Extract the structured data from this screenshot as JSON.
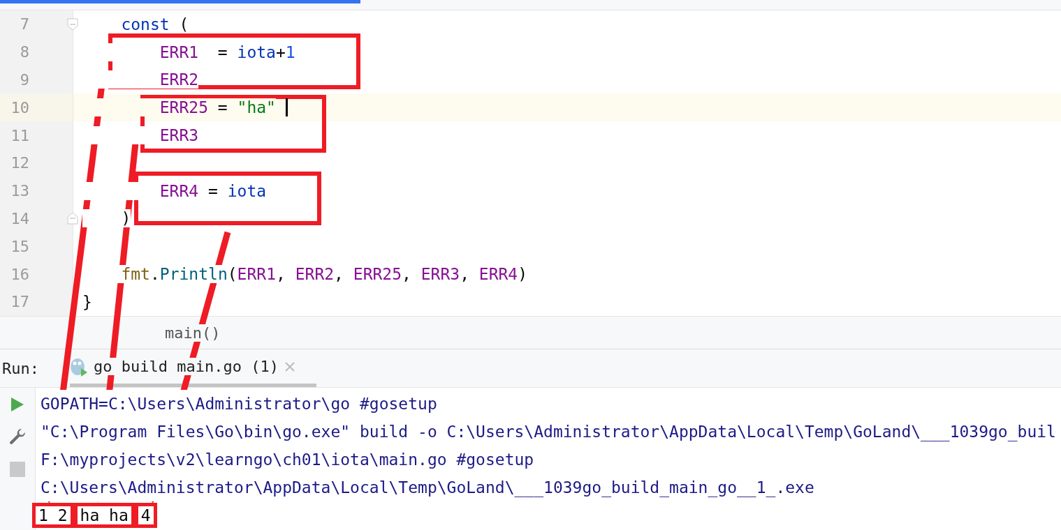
{
  "editor": {
    "lines": [
      {
        "number": "7",
        "fold": true,
        "current": false,
        "tokens": [
          {
            "kind": "keyword",
            "text": "    const"
          },
          {
            "kind": "plain",
            "text": " ("
          }
        ]
      },
      {
        "number": "8",
        "fold": false,
        "current": false,
        "tokens": [
          {
            "kind": "constant",
            "text": "        ERR1"
          },
          {
            "kind": "plain",
            "text": "  = "
          },
          {
            "kind": "keyword",
            "text": "iota"
          },
          {
            "kind": "plain",
            "text": "+"
          },
          {
            "kind": "number",
            "text": "1"
          }
        ]
      },
      {
        "number": "9",
        "fold": false,
        "current": false,
        "tokens": [
          {
            "kind": "constant",
            "text": "        ERR2"
          }
        ]
      },
      {
        "number": "10",
        "fold": false,
        "current": true,
        "tokens": [
          {
            "kind": "constant",
            "text": "        ERR25"
          },
          {
            "kind": "plain",
            "text": " = "
          },
          {
            "kind": "string",
            "text": "\"ha\""
          }
        ]
      },
      {
        "number": "11",
        "fold": false,
        "current": false,
        "tokens": [
          {
            "kind": "constant",
            "text": "        ERR3"
          }
        ]
      },
      {
        "number": "12",
        "fold": false,
        "current": false
      },
      {
        "number": "13",
        "fold": false,
        "current": false,
        "tokens": [
          {
            "kind": "constant",
            "text": "        ERR4"
          },
          {
            "kind": "plain",
            "text": " = "
          },
          {
            "kind": "keyword",
            "text": "iota"
          }
        ]
      },
      {
        "number": "14",
        "fold": true,
        "current": false,
        "tokens": [
          {
            "kind": "plain",
            "text": "    )"
          }
        ]
      },
      {
        "number": "15",
        "fold": false,
        "current": false
      },
      {
        "number": "16",
        "fold": false,
        "current": false,
        "tokens": [
          {
            "kind": "package",
            "text": "    fmt"
          },
          {
            "kind": "plain",
            "text": "."
          },
          {
            "kind": "function",
            "text": "Println"
          },
          {
            "kind": "plain",
            "text": "("
          },
          {
            "kind": "constant",
            "text": "ERR1"
          },
          {
            "kind": "plain",
            "text": ", "
          },
          {
            "kind": "constant",
            "text": "ERR2"
          },
          {
            "kind": "plain",
            "text": ", "
          },
          {
            "kind": "constant",
            "text": "ERR25"
          },
          {
            "kind": "plain",
            "text": ", "
          },
          {
            "kind": "constant",
            "text": "ERR3"
          },
          {
            "kind": "plain",
            "text": ", "
          },
          {
            "kind": "constant",
            "text": "ERR4"
          },
          {
            "kind": "plain",
            "text": ")"
          }
        ]
      },
      {
        "number": "17",
        "fold": false,
        "current": false,
        "tokens": [
          {
            "kind": "plain",
            "text": "}"
          }
        ]
      }
    ]
  },
  "breadcrumb": "main()",
  "run_panel": {
    "label": "Run:",
    "tabs": [
      {
        "title": "go build main.go (1)",
        "selected": true
      }
    ],
    "output": [
      {
        "kind": "command",
        "text": "GOPATH=C:\\Users\\Administrator\\go #gosetup"
      },
      {
        "kind": "command",
        "text": "\"C:\\Program Files\\Go\\bin\\go.exe\" build -o C:\\Users\\Administrator\\AppData\\Local\\Temp\\GoLand\\___1039go_buil"
      },
      {
        "kind": "command",
        "text": "F:\\myprojects\\v2\\learngo\\ch01\\iota\\main.go #gosetup"
      },
      {
        "kind": "command",
        "text": "C:\\Users\\Administrator\\AppData\\Local\\Temp\\GoLand\\___1039go_build_main_go__1_.exe"
      },
      {
        "kind": "result",
        "parts": [
          "1 2",
          "ha ha",
          "4"
        ]
      }
    ]
  }
}
